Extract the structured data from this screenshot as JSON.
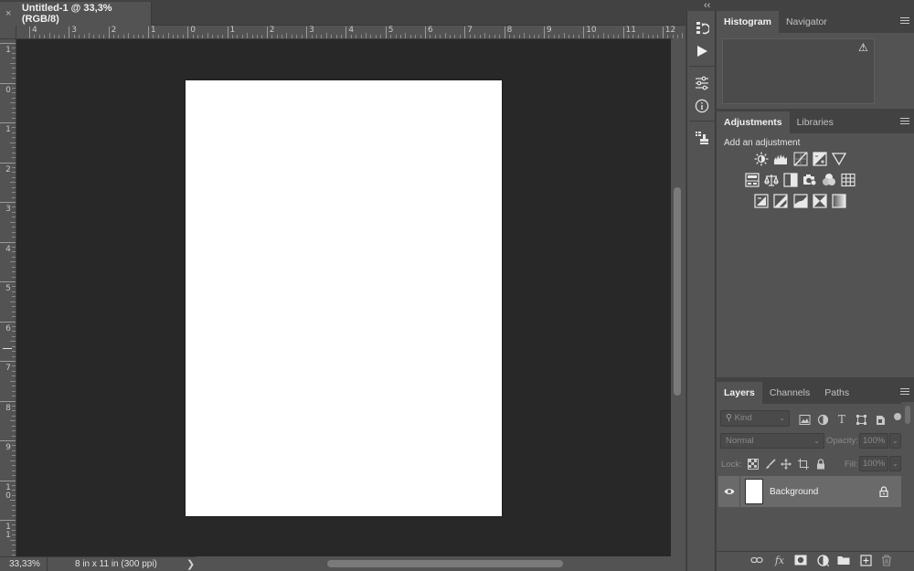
{
  "document": {
    "tab_close": "×",
    "tab_title": "Untitled-1 @ 33,3% (RGB/8)",
    "hruler_labels": [
      "4",
      "3",
      "2",
      "1",
      "0",
      "1",
      "2",
      "3",
      "4",
      "5",
      "6",
      "7",
      "8",
      "9",
      "10",
      "11",
      "12"
    ],
    "vruler_labels": [
      "1",
      "0",
      "1",
      "2",
      "3",
      "4",
      "5",
      "6",
      "7",
      "8",
      "9",
      "10",
      "11"
    ],
    "zoom": "33,33%",
    "doc_info": "8 in x 11 in (300 ppi)",
    "status_arrow": "❯",
    "canvas_color": "#ffffff",
    "pasteboard_color": "#282828"
  },
  "strip": {
    "collapse_left": "‹‹",
    "collapse_right": "››",
    "icons": [
      "history-icon",
      "play-icon",
      "adjustments-sliders-icon",
      "info-icon",
      "clone-source-icon"
    ]
  },
  "histogram_panel": {
    "tabs": [
      "Histogram",
      "Navigator"
    ],
    "warning": "⚠"
  },
  "adjustments_panel": {
    "tabs": [
      "Adjustments",
      "Libraries"
    ],
    "label": "Add an adjustment",
    "icons_row1": [
      "brightness-contrast-icon",
      "levels-icon",
      "curves-icon",
      "exposure-icon",
      "vibrance-icon"
    ],
    "icons_row2": [
      "hue-saturation-icon",
      "color-balance-icon",
      "black-white-icon",
      "photo-filter-icon",
      "channel-mixer-icon",
      "color-lookup-icon"
    ],
    "icons_row3": [
      "invert-icon",
      "posterize-icon",
      "threshold-icon",
      "selective-color-icon",
      "gradient-map-icon"
    ]
  },
  "layers_panel": {
    "tabs": [
      "Layers",
      "Channels",
      "Paths"
    ],
    "kind_placeholder": "Kind",
    "blend_mode": "Normal",
    "opacity_label": "Opacity:",
    "opacity_value": "100%",
    "lock_label": "Lock:",
    "fill_label": "Fill:",
    "fill_value": "100%",
    "layers": [
      {
        "name": "Background",
        "visible": true,
        "locked": true
      }
    ],
    "footer_icons": [
      "link-icon",
      "fx-icon",
      "mask-icon",
      "adjustment-layer-icon",
      "folder-icon",
      "new-layer-icon",
      "trash-icon"
    ]
  }
}
